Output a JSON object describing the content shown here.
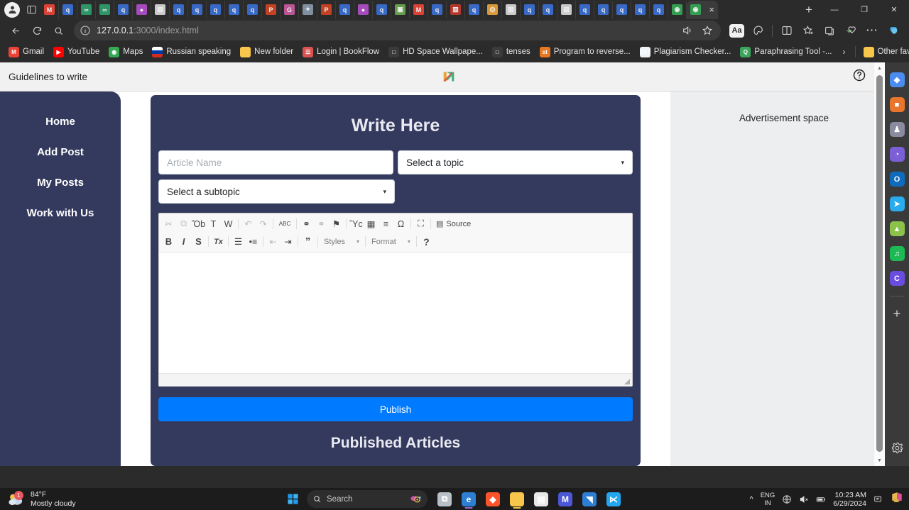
{
  "browser": {
    "tabs_left_icons": [
      "gmail-icon",
      "search-icon",
      "link-icon",
      "link-icon",
      "search-icon",
      "globe-icon",
      "news-icon",
      "search-icon",
      "search-icon",
      "search-icon",
      "search-icon",
      "search-icon",
      "powerpoint-icon",
      "chrome-icon",
      "sparkle-icon",
      "powerpoint-icon",
      "search-icon",
      "globe-icon",
      "search-icon",
      "image-icon",
      "gmail-icon",
      "search-icon",
      "book-icon",
      "search-icon",
      "gift-icon",
      "news-icon",
      "search-icon",
      "search-icon",
      "news-icon",
      "search-icon",
      "search-icon",
      "search-icon",
      "search-icon",
      "search-icon",
      "maps-icon"
    ],
    "active_tab_close_label": "×",
    "new_tab_label": "+",
    "window_minimize": "—",
    "window_maximize": "❐",
    "window_close": "✕",
    "nav": {
      "back_label": "←",
      "refresh_label": "⟳",
      "search_label": "⚲"
    },
    "omnibox": {
      "host": "127.0.0.1",
      "path": ":3000/index.html"
    },
    "toolbar_icons": [
      "read-aloud-icon",
      "favorite-star-icon",
      "immersive-reader-aa-icon",
      "browser-essentials-icon",
      "split-screen-icon",
      "favorites-icon",
      "collections-icon",
      "performance-icon",
      "more-options-icon",
      "copilot-icon"
    ],
    "aa_label": "Aa",
    "more_label": "⋯",
    "bookmarks": [
      {
        "label": "Gmail",
        "icon": "gmail-icon",
        "color": "#ea4335",
        "glyph": "M"
      },
      {
        "label": "YouTube",
        "icon": "youtube-icon",
        "color": "#ff0000",
        "glyph": "▶"
      },
      {
        "label": "Maps",
        "icon": "maps-icon",
        "color": "#34a853",
        "glyph": "◉"
      },
      {
        "label": "Russian speaking",
        "icon": "flag-icon",
        "color": "#0039a6",
        "glyph": ""
      },
      {
        "label": "New folder",
        "icon": "folder-icon",
        "color": "#f7c64b",
        "glyph": ""
      },
      {
        "label": "Login | BookFlow",
        "icon": "book-icon",
        "color": "#d9534f",
        "glyph": "☰"
      },
      {
        "label": "HD Space Wallpape...",
        "icon": "page-icon",
        "color": "#3a3a3a",
        "glyph": "□"
      },
      {
        "label": "tenses",
        "icon": "page-icon",
        "color": "#3a3a3a",
        "glyph": "□"
      },
      {
        "label": "Program to reverse...",
        "icon": "stackoverflow-icon",
        "color": "#e87722",
        "glyph": "st"
      },
      {
        "label": "Plagiarism Checker...",
        "icon": "smallseotools-icon",
        "color": "#eef3f8",
        "glyph": "SST"
      },
      {
        "label": "Paraphrasing Tool -...",
        "icon": "quillbot-icon",
        "color": "#3ba55c",
        "glyph": "Q"
      }
    ],
    "bookmarks_overflow_label": "›",
    "other_favorites": {
      "label": "Other favorites",
      "icon": "folder-icon",
      "color": "#f7c64b"
    },
    "bookmarks_search_label": "⚲",
    "sidebar_icons": [
      {
        "name": "shopping-tag-icon",
        "color": "#4a8cf0",
        "glyph": "◆"
      },
      {
        "name": "tools-icon",
        "color": "#e8762c",
        "glyph": "■"
      },
      {
        "name": "games-icon",
        "color": "#8a8aa0",
        "glyph": "♟"
      },
      {
        "name": "office-icon",
        "color": "#7b5fd6",
        "glyph": "◔"
      },
      {
        "name": "outlook-icon",
        "color": "#0f6cbd",
        "glyph": "O"
      },
      {
        "name": "telegram-icon",
        "color": "#2aabee",
        "glyph": "➤"
      },
      {
        "name": "dropbox-icon",
        "color": "#8bc34a",
        "glyph": "▲"
      },
      {
        "name": "spotify-icon",
        "color": "#1db954",
        "glyph": "♫"
      },
      {
        "name": "copilot-c-icon",
        "color": "#6b4ce0",
        "glyph": "C"
      }
    ],
    "sidebar_add_label": "+",
    "sidebar_settings_icon": "gear-icon",
    "scrollbar": {
      "up_arrow": "▲",
      "down_arrow": "▼"
    }
  },
  "page": {
    "header": {
      "guidelines_label": "Guidelines to write",
      "logo_name": "brand-logo",
      "help_icon": "help-circle-icon",
      "account_icon": "account-circle-icon"
    },
    "sidebar": {
      "items": [
        {
          "label": "Home",
          "name": "sidebar-item-home"
        },
        {
          "label": "Add Post",
          "name": "sidebar-item-add-post"
        },
        {
          "label": "My Posts",
          "name": "sidebar-item-my-posts"
        },
        {
          "label": "Work with Us",
          "name": "sidebar-item-work-with-us"
        }
      ]
    },
    "main": {
      "title": "Write Here",
      "article_name_placeholder": "Article Name",
      "article_name_value": "",
      "topic_select_value": "Select a topic",
      "subtopic_select_value": "Select a subtopic",
      "publish_label": "Publish",
      "published_articles_title": "Published Articles"
    },
    "editor": {
      "row1": [
        {
          "name": "cut-icon",
          "glyph": "✂",
          "dim": true
        },
        {
          "name": "copy-icon",
          "glyph": "⧉",
          "dim": true
        },
        {
          "name": "paste-icon",
          "glyph": "Ὄb",
          "dim": false
        },
        {
          "name": "paste-text-icon",
          "glyph": "T",
          "dim": false
        },
        {
          "name": "paste-word-icon",
          "glyph": "W",
          "dim": false
        },
        {
          "name": "undo-icon",
          "glyph": "↶",
          "dim": true
        },
        {
          "name": "redo-icon",
          "glyph": "↷",
          "dim": true
        },
        {
          "name": "spellcheck-icon",
          "glyph": "ABC",
          "dim": false
        },
        {
          "name": "link-icon",
          "glyph": "⚭",
          "dim": false
        },
        {
          "name": "unlink-icon",
          "glyph": "⚭",
          "dim": true
        },
        {
          "name": "anchor-flag-icon",
          "glyph": "⚑",
          "dim": false
        },
        {
          "name": "image-icon",
          "glyph": "Ὓc",
          "dim": false
        },
        {
          "name": "table-icon",
          "glyph": "▦",
          "dim": false
        },
        {
          "name": "horizontal-rule-icon",
          "glyph": "≡",
          "dim": false
        },
        {
          "name": "special-char-icon",
          "glyph": "Ω",
          "dim": false
        },
        {
          "name": "maximize-icon",
          "glyph": "⛶",
          "dim": false
        }
      ],
      "source_label": "Source",
      "source_icon": "source-icon",
      "row2": [
        {
          "name": "bold-icon",
          "glyph": "B",
          "dim": false
        },
        {
          "name": "italic-icon",
          "glyph": "I",
          "dim": false
        },
        {
          "name": "strikethrough-icon",
          "glyph": "S",
          "dim": false
        },
        {
          "name": "remove-format-icon",
          "glyph": "Tx",
          "dim": false
        },
        {
          "name": "numbered-list-icon",
          "glyph": "☰",
          "dim": false
        },
        {
          "name": "bulleted-list-icon",
          "glyph": "•≡",
          "dim": false
        },
        {
          "name": "outdent-icon",
          "glyph": "⇤",
          "dim": true
        },
        {
          "name": "indent-icon",
          "glyph": "⇥",
          "dim": false
        },
        {
          "name": "blockquote-icon",
          "glyph": "”",
          "dim": false
        }
      ],
      "styles_label": "Styles",
      "format_label": "Format",
      "about_label": "?",
      "combo_arrow": "▾",
      "content": ""
    },
    "advertisement": {
      "label": "Advertisement space"
    }
  },
  "taskbar": {
    "weather": {
      "temperature": "84°F",
      "condition": "Mostly cloudy",
      "badge": "1"
    },
    "start_label": "start-icon",
    "search_placeholder": "Search",
    "apps": [
      {
        "name": "task-view-icon",
        "color": "#b9bfc6",
        "glyph": "⧉",
        "indicator": ""
      },
      {
        "name": "microsoft-edge-icon",
        "color": "#2d7fd3",
        "glyph": "e",
        "indicator": "#9b6ad6"
      },
      {
        "name": "brave-browser-icon",
        "color": "#fb542b",
        "glyph": "◆",
        "indicator": ""
      },
      {
        "name": "file-explorer-icon",
        "color": "#f7c64b",
        "glyph": "",
        "indicator": "#f7c64b"
      },
      {
        "name": "microsoft-store-icon",
        "color": "#e8e8e8",
        "glyph": "▤",
        "indicator": ""
      },
      {
        "name": "mega-app-icon",
        "color": "#4b57d6",
        "glyph": "M",
        "indicator": ""
      },
      {
        "name": "photos-icon",
        "color": "#2d7fd3",
        "glyph": "◥",
        "indicator": ""
      },
      {
        "name": "visual-studio-code-icon",
        "color": "#22a7f0",
        "glyph": "⋉",
        "indicator": ""
      }
    ],
    "tray": {
      "chevron_label": "ⱎ",
      "language_line1": "ENG",
      "language_line2": "IN",
      "network_icon": "globe-icon",
      "volume_icon": "volume-muted-icon",
      "battery_icon": "battery-icon",
      "time": "10:23 AM",
      "date": "6/29/2024",
      "notification_icon": "notification-bell-icon",
      "app_icon": "office-app-icon"
    }
  }
}
